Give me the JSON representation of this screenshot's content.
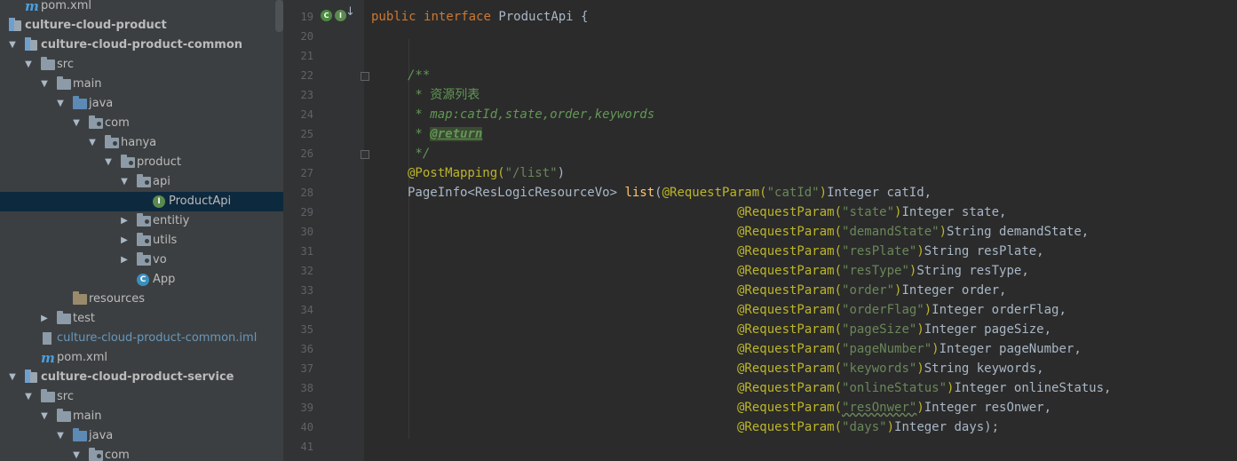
{
  "tree": {
    "items": [
      {
        "label": "pom.xml",
        "kind": "maven"
      },
      {
        "label": "culture-cloud-product",
        "kind": "module"
      },
      {
        "label": "culture-cloud-product-common",
        "kind": "module"
      },
      {
        "label": "src",
        "kind": "folder"
      },
      {
        "label": "main",
        "kind": "folder"
      },
      {
        "label": "java",
        "kind": "src"
      },
      {
        "label": "com",
        "kind": "pkg"
      },
      {
        "label": "hanya",
        "kind": "pkg"
      },
      {
        "label": "product",
        "kind": "pkg"
      },
      {
        "label": "api",
        "kind": "pkg"
      },
      {
        "label": "ProductApi",
        "kind": "interface"
      },
      {
        "label": "entitiy",
        "kind": "pkg"
      },
      {
        "label": "utils",
        "kind": "pkg"
      },
      {
        "label": "vo",
        "kind": "pkg"
      },
      {
        "label": "App",
        "kind": "class"
      },
      {
        "label": "resources",
        "kind": "res"
      },
      {
        "label": "test",
        "kind": "folder"
      },
      {
        "label": "culture-cloud-product-common.iml",
        "kind": "iml"
      },
      {
        "label": "pom.xml",
        "kind": "maven"
      },
      {
        "label": "culture-cloud-product-service",
        "kind": "module"
      },
      {
        "label": "src",
        "kind": "folder"
      },
      {
        "label": "main",
        "kind": "folder"
      },
      {
        "label": "java",
        "kind": "src"
      },
      {
        "label": "com",
        "kind": "pkg"
      }
    ]
  },
  "editor": {
    "line_numbers": [
      "19",
      "20",
      "21",
      "22",
      "23",
      "24",
      "25",
      "26",
      "27",
      "28",
      "29",
      "30",
      "31",
      "32",
      "33",
      "34",
      "35",
      "36",
      "37",
      "38",
      "39",
      "40",
      "41"
    ],
    "code": {
      "l19_public": "public",
      "l19_interface": "interface",
      "l19_name": "ProductApi {",
      "l22": "/**",
      "l23": " * 资源列表",
      "l24": " * map:catId,state,order,keywords",
      "l25_star": " * ",
      "l25_tag": "@return",
      "l26": " */",
      "l27_ann": "@PostMapping(",
      "l27_str": "\"/list\"",
      "l27_close": ")",
      "l28_type": "PageInfo<ResLogicResourceVo> ",
      "l28_fn": "list",
      "l28_open": "(",
      "params": [
        {
          "name": "\"catId\"",
          "decl": "Integer catId,"
        },
        {
          "name": "\"state\"",
          "decl": "Integer state,"
        },
        {
          "name": "\"demandState\"",
          "decl": "String demandState,"
        },
        {
          "name": "\"resPlate\"",
          "decl": "String resPlate,"
        },
        {
          "name": "\"resType\"",
          "decl": "String resType,"
        },
        {
          "name": "\"order\"",
          "decl": "Integer order,"
        },
        {
          "name": "\"orderFlag\"",
          "decl": "Integer orderFlag,"
        },
        {
          "name": "\"pageSize\"",
          "decl": "Integer pageSize,"
        },
        {
          "name": "\"pageNumber\"",
          "decl": "Integer pageNumber,"
        },
        {
          "name": "\"keywords\"",
          "decl": "String keywords,"
        },
        {
          "name": "\"onlineStatus\"",
          "decl": "Integer onlineStatus,"
        },
        {
          "name": "\"resOnwer\"",
          "decl": "Integer resOnwer,"
        },
        {
          "name": "\"days\"",
          "decl": "Integer days);"
        }
      ],
      "ann_req_open": "@RequestParam(",
      "ann_req_close": ")"
    }
  },
  "colors": {
    "keyword": "#cc7832",
    "annotation": "#bbb529",
    "string": "#6a8759",
    "comment": "#629755",
    "function": "#ffc66d",
    "text": "#a9b7c6"
  },
  "icons": {
    "gutter_implemented": "implemented-icon",
    "gutter_inheritors": "inheritors-icon"
  }
}
